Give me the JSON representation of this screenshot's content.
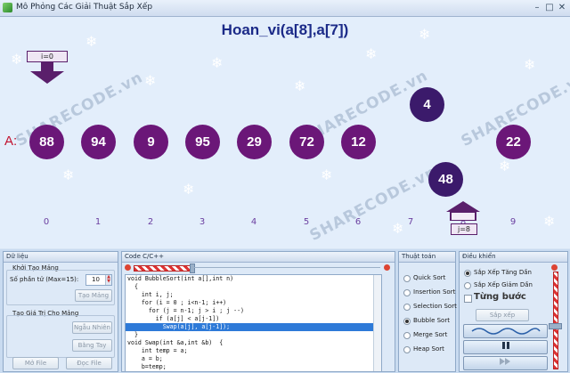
{
  "window": {
    "title": "Mô Phỏng Các Giải Thuật Sắp Xếp",
    "min": "–",
    "max": "□",
    "close": "✕"
  },
  "heading": "Hoan_vi(a[8],a[7])",
  "watermark": "SHARECODE.vn",
  "array_label": "A:",
  "circles": [
    "88",
    "94",
    "9",
    "95",
    "29",
    "72",
    "12",
    "4",
    "48",
    "22"
  ],
  "indices": [
    "0",
    "1",
    "2",
    "3",
    "4",
    "5",
    "6",
    "7",
    "8",
    "9"
  ],
  "pointer_i": "i=0",
  "pointer_j": "j=8",
  "colors": {
    "circle": "#6b1778",
    "circle_dark": "#3b1a6b",
    "heading": "#1b2a88",
    "array_label": "#c1122f",
    "highlight": "#2e7ad8"
  },
  "panels": {
    "data": {
      "title": "Dữ liệu",
      "init_group": "Khởi Tạo Mảng",
      "count_label": "Số phần tử (Max=15):",
      "count_value": "10",
      "create_btn": "Tạo Mảng",
      "value_group": "Tạo Giá Trị Cho Mảng",
      "random_btn": "Ngẫu Nhiên",
      "manual_btn": "Bằng Tay",
      "openfile_btn": "Mở File",
      "readfile_btn": "Đọc File"
    },
    "code": {
      "title": "Code C/C++",
      "lines": [
        "void BubbleSort(int a[],int n)",
        "  {",
        "    int i, j;",
        "    for (i = 0 ; i<n-1; i++)",
        "      for (j = n-1; j > i ; j --)",
        "        if (a[j] < a[j-1])",
        "          Swap(a[j], a[j-1]);",
        "  }",
        "void Swap(int &a,int &b)  {",
        "    int temp = a;",
        "    a = b;",
        "    b=temp;"
      ],
      "highlight_index": 6
    },
    "algo": {
      "title": "Thuật toán",
      "options": [
        "Quick Sort",
        "Insertion Sort",
        "Selection Sort",
        "Bubble Sort",
        "Merge Sort",
        "Heap Sort"
      ],
      "selected": "Bubble Sort"
    },
    "control": {
      "title": "Điều khiển",
      "asc": "Sắp Xếp Tăng Dần",
      "desc": "Sắp Xếp Giảm Dần",
      "step": "Từng bước",
      "sort_btn": "Sắp xếp",
      "selected": "Sắp Xếp Tăng Dần",
      "speed_fraction": 0.65
    }
  }
}
